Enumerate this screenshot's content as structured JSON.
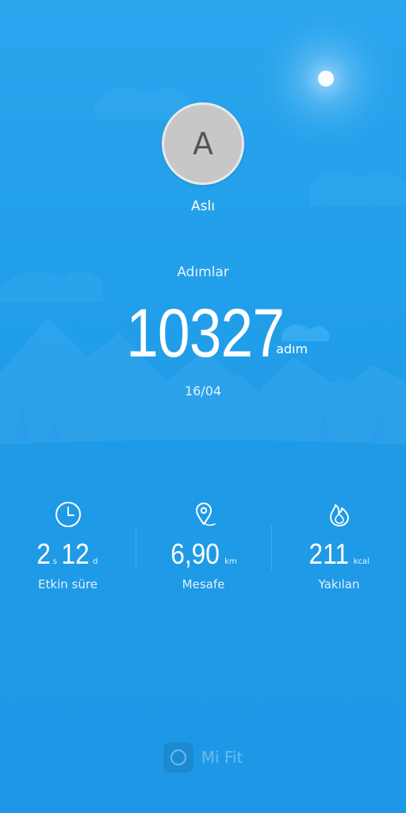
{
  "profile": {
    "initial": "A",
    "name": "Aslı"
  },
  "steps": {
    "label": "Adımlar",
    "value": "10327",
    "unit": "adım",
    "date": "16/04"
  },
  "stats": {
    "active_time": {
      "icon": "clock-icon",
      "hours": "2",
      "hours_unit": "s",
      "minutes": "12",
      "minutes_unit": "d",
      "label": "Etkin süre"
    },
    "distance": {
      "icon": "location-pin-icon",
      "value": "6,90",
      "unit": "km",
      "label": "Mesafe"
    },
    "calories": {
      "icon": "flame-icon",
      "value": "211",
      "unit": "kcal",
      "label": "Yakılan"
    }
  },
  "brand": {
    "name": "Mi Fit"
  },
  "colors": {
    "background": "#1f9ae8",
    "text": "#ffffff",
    "avatar": "#c7c7c7"
  }
}
